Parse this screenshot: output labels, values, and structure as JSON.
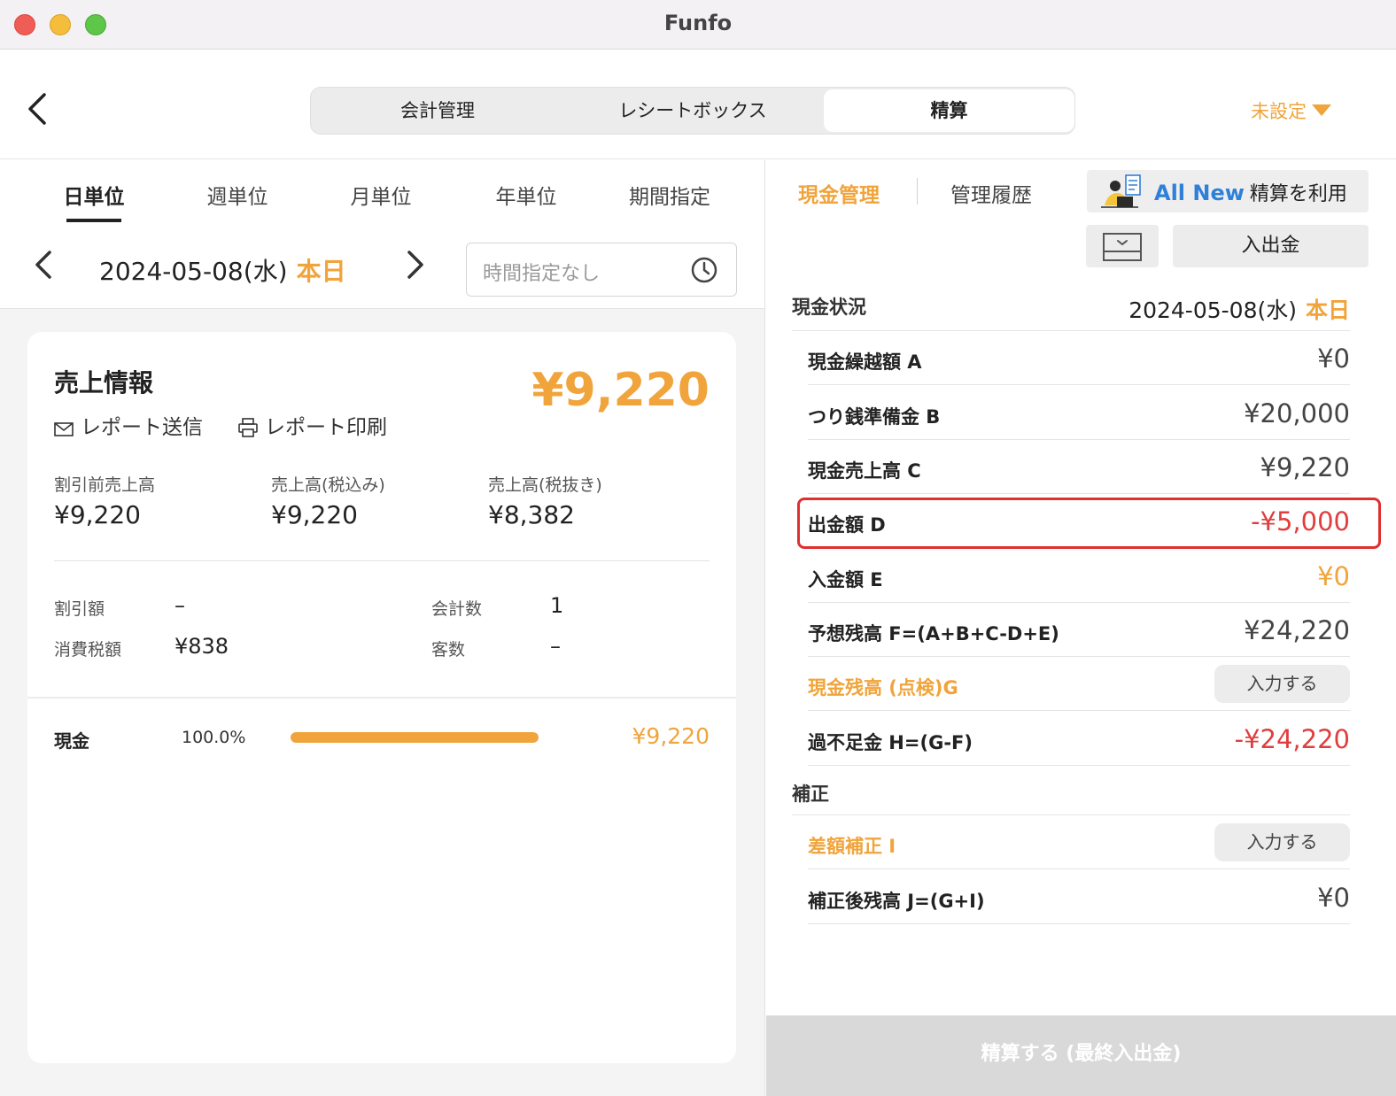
{
  "window": {
    "title": "Funfo"
  },
  "header": {
    "tabs": [
      {
        "label": "会計管理"
      },
      {
        "label": "レシートボックス"
      },
      {
        "label": "精算"
      }
    ],
    "store_select": "未設定"
  },
  "left": {
    "period_tabs": [
      {
        "label": "日単位"
      },
      {
        "label": "週単位"
      },
      {
        "label": "月単位"
      },
      {
        "label": "年単位"
      },
      {
        "label": "期間指定"
      }
    ],
    "date": "2024-05-08(水)",
    "today": "本日",
    "time_placeholder": "時間指定なし",
    "sales": {
      "title": "売上情報",
      "total": "¥9,220",
      "report_send": "レポート送信",
      "report_print": "レポート印刷",
      "stats": [
        {
          "label": "割引前売上高",
          "value": "¥9,220"
        },
        {
          "label": "売上高(税込み)",
          "value": "¥9,220"
        },
        {
          "label": "売上高(税抜き)",
          "value": "¥8,382"
        }
      ],
      "discount_label": "割引額",
      "discount_value": "–",
      "tax_label": "消費税額",
      "tax_value": "¥838",
      "count_label": "会計数",
      "count_value": "1",
      "customers_label": "客数",
      "customers_value": "–",
      "payment": {
        "label": "現金",
        "percent": "100.0%",
        "fraction": 1.0,
        "amount": "¥9,220"
      }
    }
  },
  "right": {
    "tabs": {
      "cash": "現金管理",
      "history": "管理履歴"
    },
    "allnew": {
      "highlight": "All New",
      "text": "精算を利用"
    },
    "io_button": "入出金",
    "status_head": "現金状況",
    "status_date": "2024-05-08(水)",
    "status_today": "本日",
    "rows": [
      {
        "label": "現金繰越額 A",
        "value": "¥0"
      },
      {
        "label": "つり銭準備金 B",
        "value": "¥20,000"
      },
      {
        "label": "現金売上高 C",
        "value": "¥9,220"
      },
      {
        "label": "出金額 D",
        "value": "-¥5,000"
      },
      {
        "label": "入金額 E",
        "value": "¥0"
      },
      {
        "label": "予想残高 F=(A+B+C-D+E)",
        "value": "¥24,220"
      },
      {
        "label": "現金残高 (点検)G",
        "button": "入力する"
      },
      {
        "label": "過不足金 H=(G-F)",
        "value": "-¥24,220"
      }
    ],
    "correction_head": "補正",
    "correction_rows": [
      {
        "label": "差額補正 I",
        "button": "入力する"
      },
      {
        "label": "補正後残高 J=(G+I)",
        "value": "¥0"
      }
    ],
    "settle_button": "精算する (最終入出金)"
  },
  "colors": {
    "accent": "#f0a43b",
    "negative": "#e03e3e",
    "link_blue": "#2f80d8"
  }
}
